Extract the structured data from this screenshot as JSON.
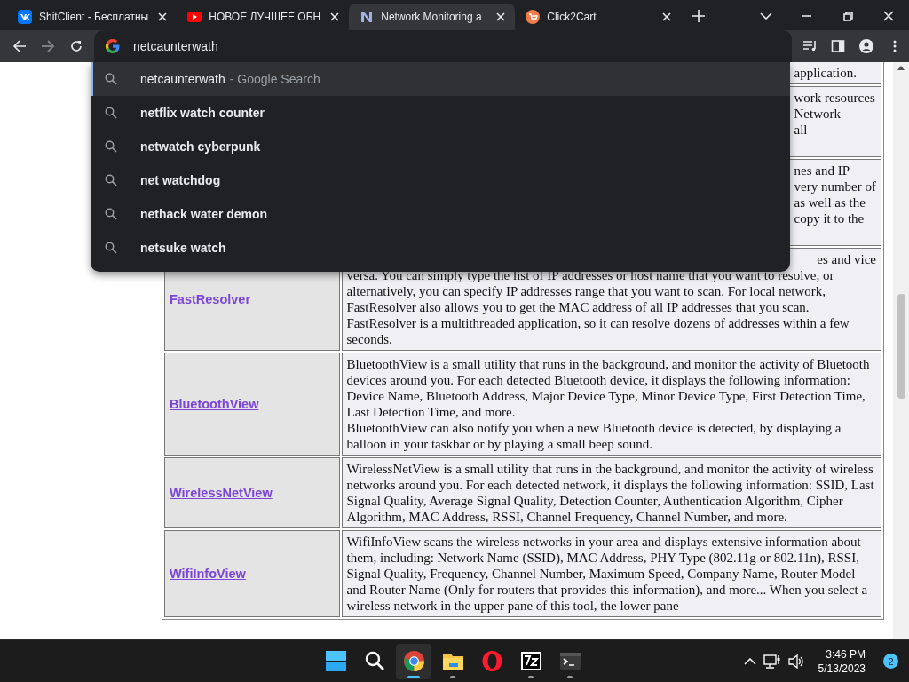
{
  "tabs": [
    {
      "title": "ShitClient - Бесплатны",
      "selected": false
    },
    {
      "title": "НОВОЕ ЛУЧШЕЕ ОБН",
      "selected": false
    },
    {
      "title": "Network Monitoring a",
      "selected": true
    },
    {
      "title": "Click2Cart",
      "selected": false
    }
  ],
  "omnibox": {
    "value": "netcaunterwath"
  },
  "suggestions": [
    {
      "kind": "typed",
      "text": "netcaunterwath",
      "suffix": "- Google Search",
      "selected": true
    },
    {
      "kind": "suggest",
      "text": "netflix watch counter",
      "selected": false
    },
    {
      "kind": "suggest",
      "text": "netwatch cyberpunk",
      "selected": false
    },
    {
      "kind": "suggest",
      "text": "net watchdog",
      "selected": false
    },
    {
      "kind": "suggest",
      "text": "nethack water demon",
      "selected": false
    },
    {
      "kind": "suggest",
      "text": "netsuke watch",
      "selected": false
    }
  ],
  "table": {
    "rows": [
      {
        "kind": "covered",
        "fragments": [
          "application."
        ]
      },
      {
        "kind": "covered",
        "fragments": [
          "work resources",
          "Network",
          "all"
        ]
      },
      {
        "kind": "covered",
        "fragments": [
          "nes and IP",
          "very number of",
          "as well as the",
          "copy it to the"
        ]
      },
      {
        "kind": "full",
        "name": "FastResolver",
        "lead_fragment": "es and vice",
        "paragraphs": [
          "versa. You can simply type the list of IP addresses or host name that you want to resolve, or alternatively, you can specify IP addresses range that you want to scan. For local network, FastResolver also allows you to get the MAC address of all IP addresses that you scan. FastResolver is a multithreaded application, so it can resolve dozens of addresses within a few seconds."
        ]
      },
      {
        "kind": "full",
        "name": "BluetoothView",
        "paragraphs": [
          "BluetoothView is a small utility that runs in the background, and monitor the activity of Bluetooth devices around you. For each detected Bluetooth device, it displays the following information: Device Name, Bluetooth Address, Major Device Type, Minor Device Type, First Detection Time, Last Detection Time, and more.",
          "BluetoothView can also notify you when a new Bluetooth device is detected, by displaying a balloon in your taskbar or by playing a small beep sound."
        ]
      },
      {
        "kind": "full",
        "name": "WirelessNetView",
        "paragraphs": [
          "WirelessNetView is a small utility that runs in the background, and monitor the activity of wireless networks around you. For each detected network, it displays the following information: SSID, Last Signal Quality, Average Signal Quality, Detection Counter, Authentication Algorithm, Cipher Algorithm, MAC Address, RSSI, Channel Frequency, Channel Number, and more."
        ]
      },
      {
        "kind": "full",
        "name": "WifiInfoView",
        "paragraphs": [
          "WifiInfoView scans the wireless networks in your area and displays extensive information about them, including: Network Name (SSID), MAC Address, PHY Type (802.11g or 802.11n), RSSI, Signal Quality, Frequency, Channel Number, Maximum Speed, Company Name, Router Model and Router Name (Only for routers that provides this information), and more... When you select a wireless network in the upper pane of this tool, the lower pane"
        ]
      }
    ]
  },
  "taskbar": {
    "apps": [
      {
        "running": false,
        "selected": false
      },
      {
        "running": false,
        "selected": false
      },
      {
        "running": true,
        "selected": true
      },
      {
        "running": true,
        "selected": false
      },
      {
        "running": false,
        "selected": false
      },
      {
        "running": true,
        "selected": false
      },
      {
        "running": true,
        "selected": false
      }
    ],
    "time": "3:46 PM",
    "date": "5/13/2023",
    "notifications": "2"
  }
}
